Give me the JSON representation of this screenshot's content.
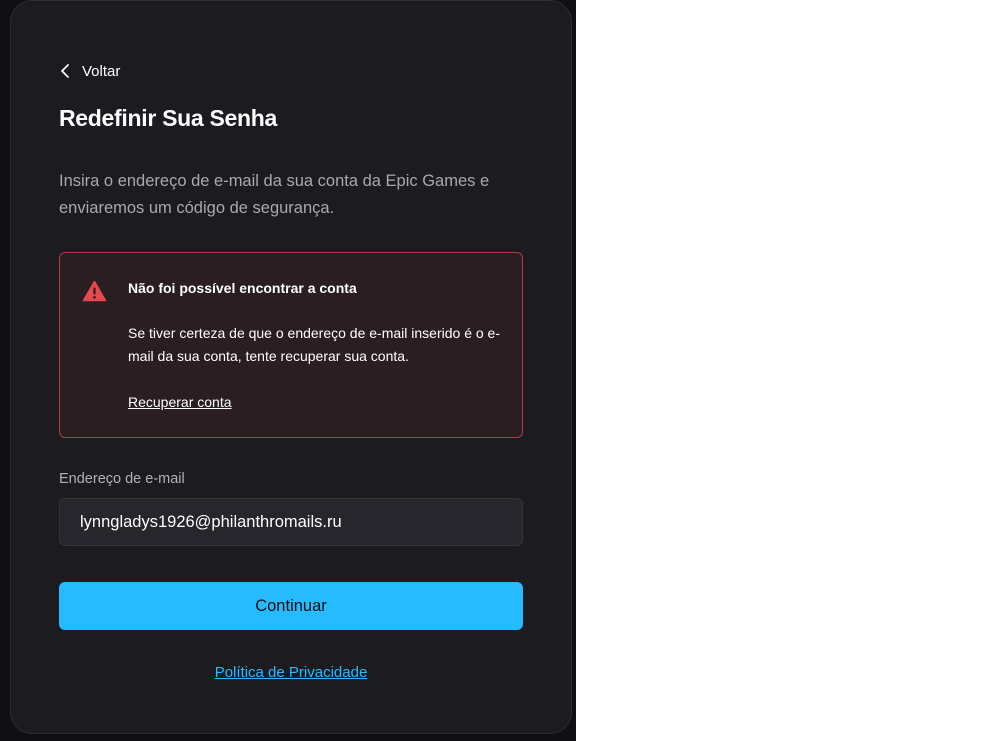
{
  "back": {
    "label": "Voltar",
    "icon": "chevron-left-icon"
  },
  "title": "Redefinir Sua Senha",
  "description": "Insira o endereço de e-mail da sua conta da Epic Games e enviaremos um código de segurança.",
  "alert": {
    "icon": "warning-triangle-icon",
    "title": "Não foi possível encontrar a conta",
    "body": "Se tiver certeza de que o endereço de e-mail inserido é o e-mail da sua conta, tente recuperar sua conta.",
    "link": "Recuperar conta",
    "color": "#e5484d"
  },
  "email_field": {
    "label": "Endereço de e-mail",
    "value": "lynngladys1926@philanthromails.ru"
  },
  "continue_button": {
    "label": "Continuar",
    "color": "#26bbff"
  },
  "privacy_link": "Política de Privacidade"
}
